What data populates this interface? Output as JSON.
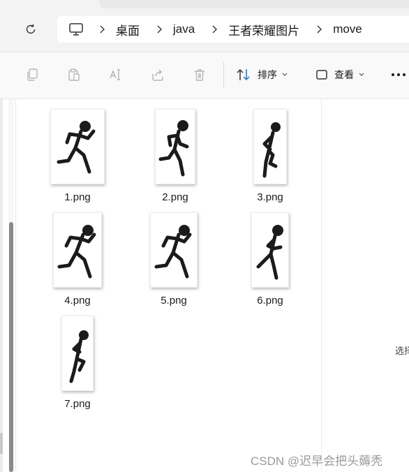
{
  "address_bar": {
    "breadcrumb": [
      "桌面",
      "java",
      "王者荣耀图片",
      "move"
    ]
  },
  "command_bar": {
    "sort_label": "排序",
    "view_label": "查看"
  },
  "files": [
    {
      "name": "1.png",
      "pose": "run-stride"
    },
    {
      "name": "2.png",
      "pose": "run-lean"
    },
    {
      "name": "3.png",
      "pose": "stand-side"
    },
    {
      "name": "4.png",
      "pose": "run-stride"
    },
    {
      "name": "5.png",
      "pose": "run-stride"
    },
    {
      "name": "6.png",
      "pose": "run-knee"
    },
    {
      "name": "7.png",
      "pose": "run-knee-up"
    }
  ],
  "details_pane": {
    "hint": "选择"
  },
  "watermark": "CSDN @迟早会把头薅秃",
  "colors": {
    "figure": "#1b1b1b",
    "accent": "#1a73e8"
  }
}
